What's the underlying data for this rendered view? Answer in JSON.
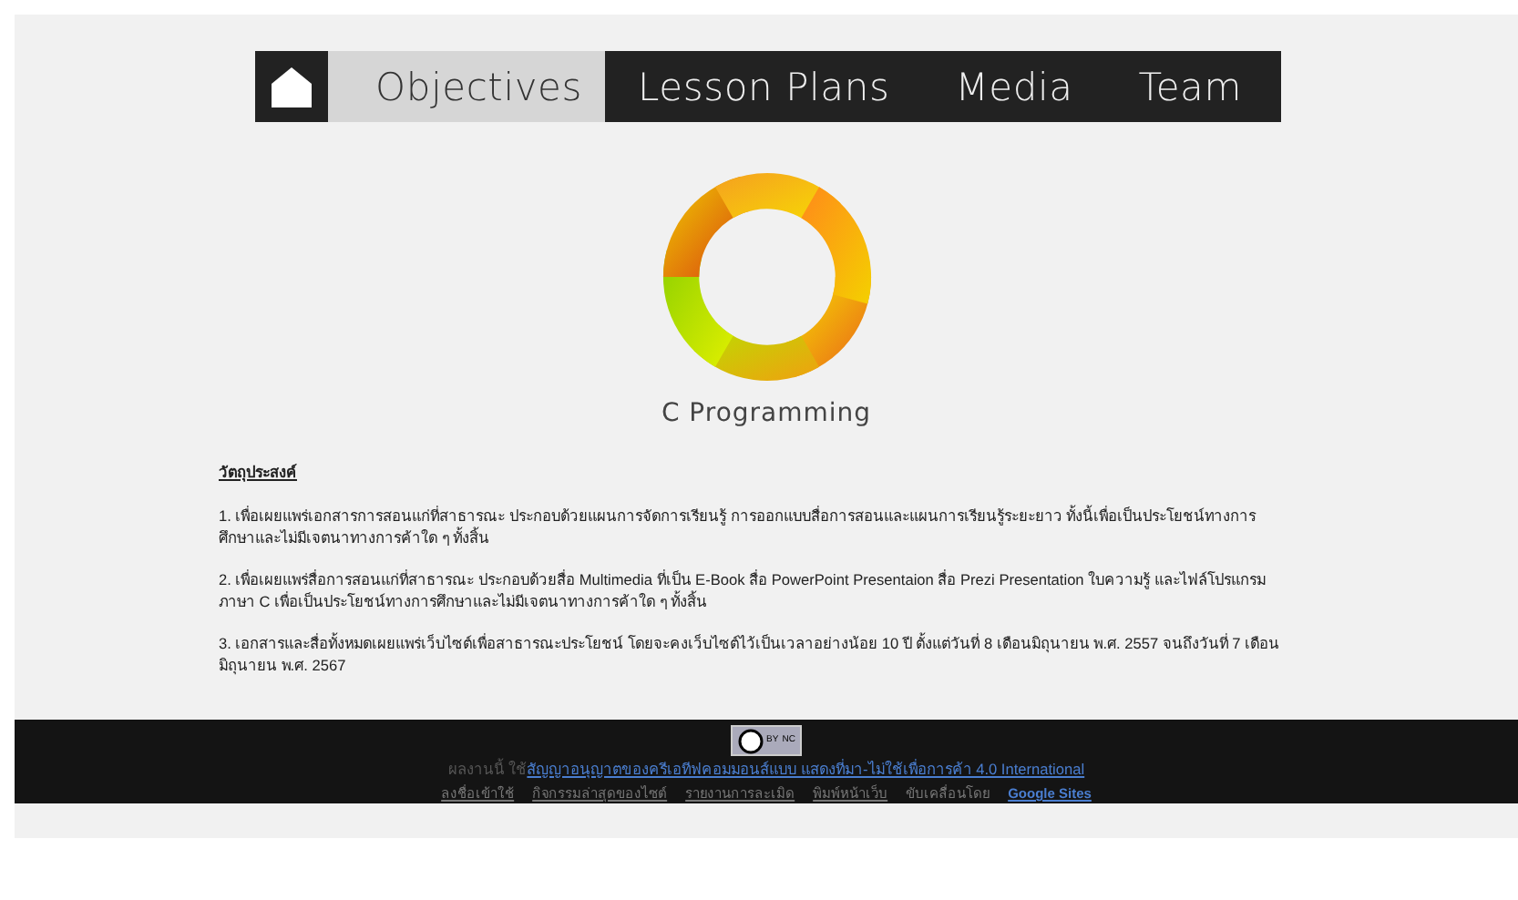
{
  "nav": {
    "tabs": [
      {
        "label": "Objectives",
        "selected": true
      },
      {
        "label": "Lesson Plans",
        "selected": false
      },
      {
        "label": "Media",
        "selected": false
      },
      {
        "label": "Team",
        "selected": false
      }
    ]
  },
  "logo": {
    "caption": "C Programming"
  },
  "content": {
    "heading": "วัตถุประสงค์",
    "paragraphs": [
      "1. เพื่อเผยแพร่เอกสารการสอนแก่ที่สาธารณะ ประกอบด้วยแผนการจัดการเรียนรู้ การออกแบบสื่อการสอนและแผนการเรียนรู้ระยะยาว ทั้งนี้เพื่อเป็นประโยชน์ทางการศึกษาและไม่มีเจตนาทางการค้าใด ๆ ทั้งสิ้น",
      "2. เพื่อเผยแพร่สื่อการสอนแก่ที่สาธารณะ ประกอบด้วยสื่อ Multimedia ที่เป็น E-Book  สื่อ PowerPoint Presentaion สื่อ Prezi Presentation ใบความรู้ และไฟล์โปรแกรมภาษา C เพื่อเป็นประโยชน์ทางการศึกษาและไม่มีเจตนาทางการค้าใด ๆ ทั้งสิ้น",
      "3. เอกสารและสื่อทั้งหมดเผยแพร่เว็บไซต์เพื่อสาธารณะประโยชน์ โดยจะคงเว็บไซต์ไว้เป็นเวลาอย่างน้อย 10 ปี ตั้งแต่วันที่ 8 เดือนมิถุนายน พ.ศ. 2557 จนถึงวันที่ 7 เดือนมิถุนายน พ.ศ. 2567"
    ]
  },
  "footer": {
    "license_badge": {
      "by": "BY",
      "nc": "NC"
    },
    "license_prefix": "ผลงานนี้ ใช้",
    "license_link": "สัญญาอนุญาตของครีเอทีฟคอมมอนส์แบบ แสดงที่มา-ไม่ใช้เพื่อการค้า 4.0 International",
    "links": [
      {
        "label": "ลงชื่อเข้าใช้",
        "kind": "link"
      },
      {
        "label": "กิจกรรมล่าสุดของไซต์",
        "kind": "link"
      },
      {
        "label": "รายงานการละเมิด",
        "kind": "link"
      },
      {
        "label": "พิมพ์หน้าเว็บ",
        "kind": "link"
      },
      {
        "label": "ขับเคลื่อนโดย",
        "kind": "text"
      },
      {
        "label": "Google Sites",
        "kind": "brand"
      }
    ]
  }
}
